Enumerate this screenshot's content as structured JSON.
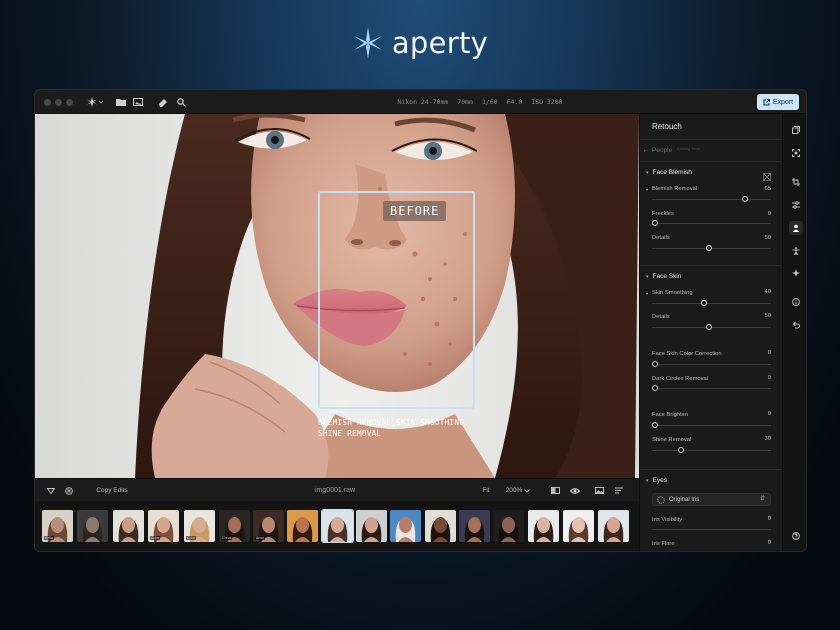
{
  "brand": {
    "name": "aperty"
  },
  "topbar": {
    "camera_meta": [
      "Nikon 24-70mm",
      "70mm",
      "1/60",
      "F4.0",
      "ISO 3200"
    ],
    "export_label": "Export"
  },
  "canvas": {
    "before_label": "BEFORE",
    "caption_line1": "BLEMISH REMOVAL,SKIN SMOOTHING,",
    "caption_line2": "SHINE REMOVAL"
  },
  "bottombar": {
    "copy_edits": "Copy Edits",
    "filename": "img0001.raw",
    "fit": "Fit",
    "zoom": "200%"
  },
  "panel": {
    "title": "Retouch",
    "people": {
      "label": "People",
      "note": "Coming Soon"
    },
    "face_blemish": {
      "title": "Face Blemish",
      "blemish_removal": {
        "label": "Blemish Removal",
        "value": "65"
      },
      "freckles": {
        "label": "Freckles",
        "value": "0"
      },
      "details": {
        "label": "Details",
        "value": "50"
      }
    },
    "face_skin": {
      "title": "Face Skin",
      "skin_smoothing": {
        "label": "Skin Smoothing",
        "value": "40"
      },
      "details": {
        "label": "Details",
        "value": "50"
      },
      "color_correction": {
        "label": "Face Skin Color Correction",
        "value": "0"
      },
      "dark_circles": {
        "label": "Dark Circles Removal",
        "value": "0"
      },
      "brighten": {
        "label": "Face Brighten",
        "value": "0"
      },
      "shine_removal": {
        "label": "Shine Removal",
        "value": "30"
      }
    },
    "eyes": {
      "title": "Eyes",
      "iris_select": "Original Iris",
      "iris_visibility": {
        "label": "Iris Visibility",
        "value": "0"
      },
      "iris_flare": {
        "label": "Iris Flare",
        "value": "0"
      }
    }
  },
  "filmstrip": {
    "thumbs": [
      {
        "tag": "Bella"
      },
      {
        "tag": ""
      },
      {
        "tag": ""
      },
      {
        "tag": "Color"
      },
      {
        "tag": "Color"
      },
      {
        "tag": "Great"
      },
      {
        "tag": "Amm"
      },
      {
        "tag": ""
      },
      {
        "tag": ""
      },
      {
        "tag": ""
      },
      {
        "tag": ""
      },
      {
        "tag": ""
      },
      {
        "tag": ""
      },
      {
        "tag": ""
      },
      {
        "tag": ""
      },
      {
        "tag": ""
      },
      {
        "tag": ""
      }
    ]
  },
  "colors": {
    "accent": "#cbe6fb",
    "selection": "#c3dff3",
    "panel_bg": "#1b1b1b"
  }
}
